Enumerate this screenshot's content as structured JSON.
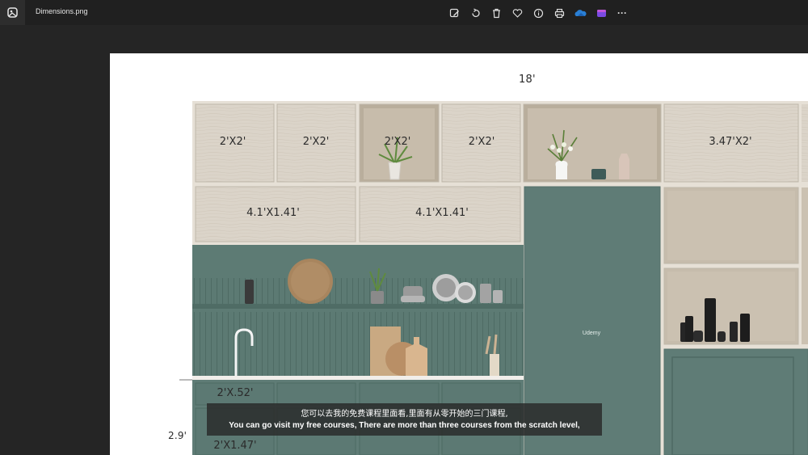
{
  "titlebar": {
    "file_name": "Dimensions.png",
    "icons": [
      "photos-app-icon",
      "edit-image-icon",
      "rotate-icon",
      "delete-icon",
      "favorite-icon",
      "info-icon",
      "print-icon",
      "onedrive-icon",
      "clipchamp-icon",
      "more-options-icon"
    ],
    "more_label": "···"
  },
  "drawing": {
    "top_dimension": "18'",
    "side_dimension": "2.9'",
    "labels": {
      "upper_1": "2'X2'",
      "upper_2": "2'X2'",
      "upper_3": "2'X2'",
      "upper_4": "2'X2'",
      "upper_right": "3.47'X2'",
      "mid_1": "4.1'X1.41'",
      "mid_2": "4.1'X1.41'",
      "base_1": "2'X.52'",
      "base_2": "2'X1.47'"
    },
    "watermark": "Udemy",
    "colors": {
      "wood": "#d9d2c7",
      "green": "#5f7c76",
      "dark_green": "#52706a",
      "shelf_inside": "#c9bfb0"
    }
  },
  "subtitles": {
    "zh": "您可以去我的免费课程里面看,里面有从零开始的三门课程,",
    "en": "You can go visit my free courses, There are more than three courses from the scratch level,"
  }
}
